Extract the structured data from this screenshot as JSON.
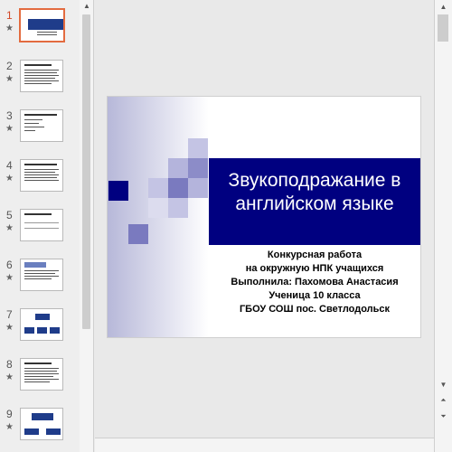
{
  "thumbnails": [
    {
      "number": "1",
      "star": "★"
    },
    {
      "number": "2",
      "star": "★"
    },
    {
      "number": "3",
      "star": "★"
    },
    {
      "number": "4",
      "star": "★"
    },
    {
      "number": "5",
      "star": "★"
    },
    {
      "number": "6",
      "star": "★"
    },
    {
      "number": "7",
      "star": "★"
    },
    {
      "number": "8",
      "star": "★"
    },
    {
      "number": "9",
      "star": "★"
    }
  ],
  "slide": {
    "title_line1": "Звукоподражание в",
    "title_line2": "английском языке",
    "subtitle": [
      "Конкурсная работа",
      "на окружную НПК учащихся",
      "Выполнила: Пахомова Анастасия",
      "Ученица 10 класса",
      "ГБОУ СОШ пос. Светлодольск"
    ]
  },
  "colors": {
    "title_bar": "#000080",
    "active_thumbnail_border": "#e36b3f",
    "accent_square_dark": "#22228a",
    "accent_square_mid": "#7a7abf",
    "accent_square_light": "#c4c4e4"
  },
  "icons": {
    "scroll_up": "▲",
    "scroll_down": "▼",
    "prev_slide": "⏶",
    "next_slide": "⏷"
  }
}
